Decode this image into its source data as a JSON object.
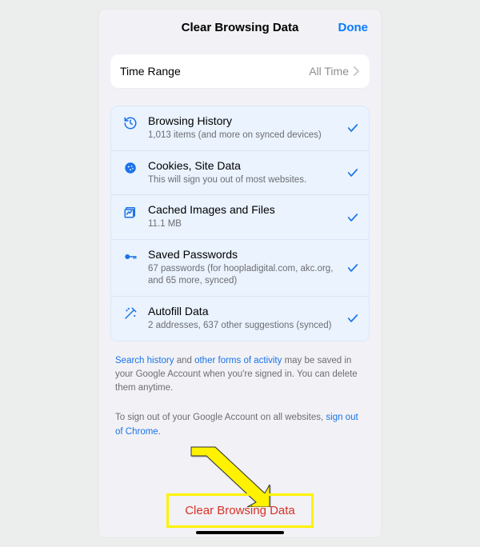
{
  "header": {
    "title": "Clear Browsing Data",
    "done": "Done"
  },
  "timeRange": {
    "label": "Time Range",
    "value": "All Time"
  },
  "options": [
    {
      "icon": "history-icon",
      "title": "Browsing History",
      "sub": "1,013 items (and more on synced devices)"
    },
    {
      "icon": "cookie-icon",
      "title": "Cookies, Site Data",
      "sub": "This will sign you out of most websites."
    },
    {
      "icon": "cache-icon",
      "title": "Cached Images and Files",
      "sub": "11.1 MB"
    },
    {
      "icon": "key-icon",
      "title": "Saved Passwords",
      "sub": "67 passwords (for hoopladigital.com, akc.org, and 65 more, synced)"
    },
    {
      "icon": "autofill-icon",
      "title": "Autofill Data",
      "sub": "2 addresses, 637 other suggestions (synced)"
    }
  ],
  "note1": {
    "link1": "Search history",
    "mid1": " and ",
    "link2": "other forms of activity",
    "tail": " may be saved in your Google Account when you're signed in. You can delete them anytime."
  },
  "note2": {
    "lead": "To sign out of your Google Account on all websites, ",
    "link": "sign out of Chrome",
    "tail": "."
  },
  "clearButton": "Clear Browsing Data"
}
